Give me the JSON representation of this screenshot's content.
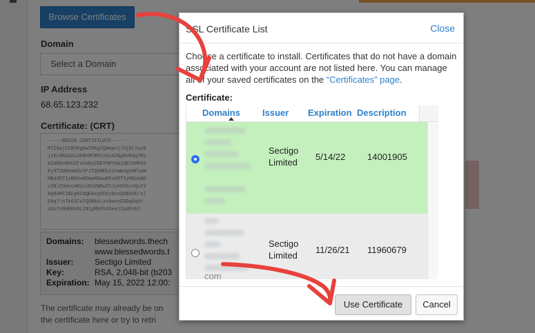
{
  "background": {
    "browse_button": "Browse Certificates",
    "domain_label": "Domain",
    "domain_placeholder": "Select a Domain",
    "ip_label": "IP Address",
    "ip_value": "68.65.123.232",
    "certificate_label": "Certificate: (CRT)",
    "crt_lines": [
      "-----BEGIN CERTIFICATE-----",
      "MIIGajCCBVKgAwIBAgIQAmpnj/UjbLIyz8",
      "jzELMAkGA1UEBhMCR0IxGzAZBgNVBAgTEk",
      "A1UEBxMHU2FsZm9yZDEYMBYGA1UEChMPU2",
      "Ey5TZWN0aWdvIFJTQSBEb21haW4gVmFsaW",
      "MB4XDTIxMDUxNDAwMDAwMFoXDTIyMDUxND",
      "c3NlZHdvcmRzLnRoZWNoZXJyeXhhcnQuY2",
      "AQ8AMIIBCgKCAQEAxgOOXyboxQdBSUE/sl",
      "EAq7/nTkGJCaTQOBbiLzvbwvnZGDg6qVc",
      "z6cfcRHEKkNL281gMhPh26eeJ2pdEVhC"
    ],
    "info": {
      "domains_key": "Domains:",
      "domains_value": "blessedwords.thech",
      "domains_value_2": "www.blessedwords.t",
      "issuer_key": "Issuer:",
      "issuer_value": "Sectigo Limited",
      "key_key": "Key:",
      "key_value": "RSA, 2,048-bit (b203",
      "expiration_key": "Expiration:",
      "expiration_value": "May 15, 2022 12:00:"
    },
    "footer_line_1": "The certificate may already be on",
    "footer_line_2": "the certificate here or try to retri"
  },
  "modal": {
    "title": "SSL Certificate List",
    "close_label": "Close",
    "instructions_text": "Choose a certificate to install. Certificates that do not have a domain associated with your account are not listed here. You can manage all of your saved certificates on the",
    "instructions_link": "“Certificates” page",
    "instructions_end": ".",
    "certificate_label": "Certificate:",
    "columns": {
      "domains": "Domains",
      "issuer": "Issuer",
      "expiration": "Expiration",
      "description": "Description"
    },
    "rows": [
      {
        "selected": true,
        "issuer_1": "Sectigo",
        "issuer_2": "Limited",
        "expiration": "5/14/22",
        "description": "14001905"
      },
      {
        "selected": false,
        "issuer_1": "Sectigo",
        "issuer_2": "Limited",
        "expiration": "11/26/21",
        "description": "11960679",
        "domain_fragment": "com"
      }
    ],
    "use_button": "Use Certificate",
    "cancel_button": "Cancel"
  },
  "annotation": {
    "arrow_color": "#e8413c"
  }
}
